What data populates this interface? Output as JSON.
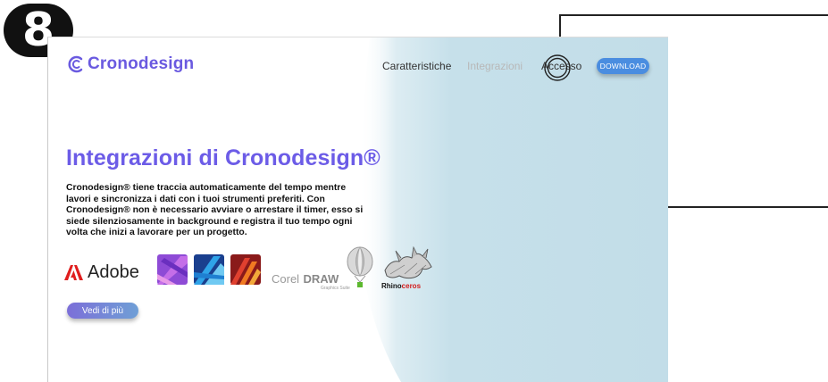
{
  "step_badge": {
    "number": "8"
  },
  "header": {
    "logo_text": "Cronodesign",
    "nav": [
      "Caratteristiche",
      "Integrazioni",
      "Accesso"
    ],
    "download_label": "DOWNLOAD"
  },
  "hero": {
    "title": "Integrazioni di Cronodesign®",
    "description": "Cronodesign® tiene traccia automaticamente del tempo mentre lavori e sincronizza i dati con i tuoi strumenti preferiti. Con Cronodesign® non è necessario avviare o arrestare il timer, esso si siede silenziosamente in background e registra il tuo tempo ogni volta che inizi a lavorare per un progetto.",
    "more_button": "Vedi di più"
  },
  "integrations": {
    "adobe": "Adobe",
    "corel": "Corel",
    "corel_draw": "DRAW",
    "corel_sub": "Graphics Suite",
    "rhino_a": "Rhino",
    "rhino_b": "ceros"
  },
  "colors": {
    "brand": "#6c5ce7",
    "download": "#4a8de0",
    "wash": "#c6e0ea"
  },
  "icons": [
    "step-8-badge",
    "cronodesign-logo-icon",
    "adobe-icon",
    "affinity-photo-icon",
    "affinity-designer-icon",
    "affinity-publisher-icon",
    "corel-balloon-icon",
    "rhino-icon",
    "cursor-click-rings"
  ]
}
